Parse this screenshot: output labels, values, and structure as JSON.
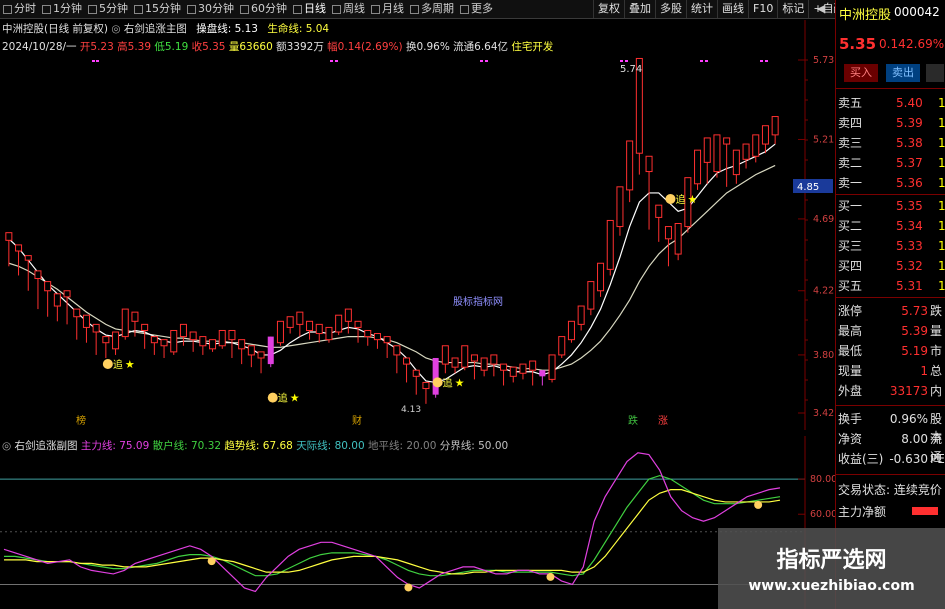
{
  "toolbar": {
    "periods": [
      "分时",
      "1分钟",
      "5分钟",
      "15分钟",
      "30分钟",
      "60分钟",
      "日线",
      "周线",
      "月线",
      "多周期",
      "更多"
    ],
    "active_period": "日线",
    "tools": [
      "复权",
      "叠加",
      "多股",
      "统计",
      "画线",
      "F10",
      "标记",
      "+自选"
    ],
    "back_glyph": "◀"
  },
  "header": {
    "line1": {
      "stock": "中洲控股(日线 前复权)",
      "indicator": "右剑追涨主图",
      "op_label": "操盘线: 5.13",
      "life_label": "生命线: 5.04"
    },
    "line2": {
      "date": "2024/10/28/一",
      "open": "开5.23",
      "high": "高5.39",
      "low": "低5.19",
      "close": "收5.35",
      "volume": "量63660",
      "amount": "额3392万",
      "change": "幅0.14(2.69%)",
      "turnover": "换0.96%",
      "float": "流通6.64亿",
      "sector": "住宅开发"
    }
  },
  "main_chart": {
    "peak_label": "5.74",
    "center_watermark": "股标指标网",
    "current_price_tag": "4.85",
    "signal_text": "追",
    "low_label": "4.13",
    "bottom_markers": [
      {
        "text": "榜",
        "color": "#d4a000"
      },
      {
        "text": "财",
        "color": "#d4a000"
      },
      {
        "text": "跌",
        "color": "#40c040"
      },
      {
        "text": "涨",
        "color": "#ff4040"
      }
    ]
  },
  "price_axis": [
    "5.73",
    "5.21",
    "4.69",
    "4.22",
    "3.80",
    "3.42"
  ],
  "sub_header": {
    "title": "右剑追涨副图",
    "lines": [
      {
        "label": "主力线: 75.09",
        "color": "#e040e0"
      },
      {
        "label": "散户线: 70.32",
        "color": "#40d040"
      },
      {
        "label": "趋势线: 67.68",
        "color": "#ffff40"
      },
      {
        "label": "天际线: 80.00",
        "color": "#40c0c0"
      },
      {
        "label": "地平线: 20.00",
        "color": "#808080"
      },
      {
        "label": "分界线: 50.00",
        "color": "#c0c0c0"
      }
    ]
  },
  "sub_axis": [
    "80.00",
    "60.00"
  ],
  "chart_data": {
    "type": "candlestick",
    "ylim": [
      3.42,
      5.73
    ],
    "candles": [
      [
        5.12,
        5.38,
        5.32,
        5.05
      ],
      [
        5.15,
        5.42,
        5.4,
        5.25
      ],
      [
        5.22,
        5.35,
        5.3,
        5.05
      ],
      [
        5.35,
        5.38,
        5.28,
        5.0
      ],
      [
        5.18,
        5.25,
        5.3,
        5.02
      ],
      [
        5.12,
        5.22,
        5.18,
        5.0
      ],
      [
        5.03,
        5.1,
        5.18,
        4.95
      ],
      [
        5.1,
        5.06,
        5.12,
        5.0
      ],
      [
        5.12,
        5.22,
        5.26,
        5.08
      ],
      [
        5.28,
        5.22,
        5.33,
        5.18
      ],
      [
        5.2,
        5.16,
        5.24,
        5.1
      ],
      [
        5.2,
        5.25,
        5.3,
        5.16
      ],
      [
        5.27,
        5.35,
        5.4,
        5.23
      ],
      [
        5.31,
        5.3,
        5.36,
        5.25
      ]
    ],
    "note": "scaled to visible price range"
  },
  "candles_main": [
    [
      4.55,
      4.6,
      4.48,
      4.38
    ],
    [
      4.48,
      4.52,
      4.4,
      4.32
    ],
    [
      4.42,
      4.45,
      4.28,
      4.22
    ],
    [
      4.3,
      4.35,
      4.2,
      4.1
    ],
    [
      4.22,
      4.28,
      4.12,
      4.05
    ],
    [
      4.12,
      4.2,
      4.18,
      4.02
    ],
    [
      4.18,
      4.22,
      4.05,
      4.0
    ],
    [
      4.05,
      4.1,
      3.96,
      3.9
    ],
    [
      3.98,
      4.06,
      3.94,
      3.88
    ],
    [
      3.95,
      4.0,
      3.85,
      3.8
    ],
    [
      3.88,
      3.92,
      3.82,
      3.78
    ],
    [
      3.84,
      3.95,
      3.92,
      3.8
    ],
    [
      3.92,
      4.1,
      4.05,
      3.9
    ],
    [
      4.02,
      4.08,
      3.96,
      3.92
    ],
    [
      3.96,
      4.0,
      3.88,
      3.84
    ],
    [
      3.88,
      3.92,
      3.85,
      3.8
    ],
    [
      3.86,
      3.9,
      3.82,
      3.78
    ],
    [
      3.82,
      3.96,
      3.94,
      3.8
    ],
    [
      3.92,
      4.0,
      3.9,
      3.86
    ],
    [
      3.9,
      3.95,
      3.86,
      3.82
    ],
    [
      3.86,
      3.92,
      3.84,
      3.8
    ],
    [
      3.84,
      3.9,
      3.86,
      3.82
    ],
    [
      3.86,
      3.96,
      3.92,
      3.84
    ],
    [
      3.9,
      3.96,
      3.84,
      3.78
    ],
    [
      3.84,
      3.9,
      3.78,
      3.74
    ],
    [
      3.8,
      3.86,
      3.76,
      3.72
    ],
    [
      3.78,
      3.82,
      3.72,
      3.68
    ],
    [
      3.74,
      3.92,
      3.88,
      3.72
    ],
    [
      3.88,
      4.02,
      3.98,
      3.86
    ],
    [
      3.98,
      4.05,
      4.02,
      3.94
    ],
    [
      4.0,
      4.08,
      3.96,
      3.92
    ],
    [
      3.96,
      4.02,
      3.94,
      3.9
    ],
    [
      3.94,
      4.0,
      3.9,
      3.88
    ],
    [
      3.9,
      3.98,
      3.96,
      3.88
    ],
    [
      3.95,
      4.06,
      4.04,
      3.93
    ],
    [
      4.02,
      4.1,
      3.98,
      3.94
    ],
    [
      3.98,
      4.02,
      3.92,
      3.88
    ],
    [
      3.92,
      3.96,
      3.9,
      3.86
    ],
    [
      3.9,
      3.94,
      3.88,
      3.84
    ],
    [
      3.88,
      3.92,
      3.8,
      3.78
    ],
    [
      3.8,
      3.86,
      3.72,
      3.68
    ],
    [
      3.74,
      3.78,
      3.66,
      3.62
    ],
    [
      3.66,
      3.7,
      3.58,
      3.54
    ],
    [
      3.58,
      3.62,
      3.52,
      3.48
    ],
    [
      3.54,
      3.78,
      3.76,
      3.52
    ],
    [
      3.74,
      3.86,
      3.72,
      3.68
    ],
    [
      3.72,
      3.78,
      3.74,
      3.68
    ],
    [
      3.72,
      3.86,
      3.76,
      3.7
    ],
    [
      3.76,
      3.8,
      3.7,
      3.64
    ],
    [
      3.7,
      3.78,
      3.74,
      3.66
    ],
    [
      3.74,
      3.8,
      3.7,
      3.66
    ],
    [
      3.7,
      3.74,
      3.66,
      3.6
    ],
    [
      3.66,
      3.72,
      3.68,
      3.62
    ],
    [
      3.68,
      3.74,
      3.7,
      3.64
    ],
    [
      3.7,
      3.76,
      3.66,
      3.6
    ],
    [
      3.66,
      3.7,
      3.64,
      3.6
    ],
    [
      3.64,
      3.8,
      3.78,
      3.62
    ],
    [
      3.8,
      3.92,
      3.9,
      3.78
    ],
    [
      3.9,
      4.02,
      4.0,
      3.88
    ],
    [
      4.0,
      4.12,
      4.1,
      3.96
    ],
    [
      4.1,
      4.28,
      4.24,
      4.06
    ],
    [
      4.22,
      4.4,
      4.36,
      4.18
    ],
    [
      4.36,
      4.68,
      4.64,
      4.32
    ],
    [
      4.64,
      4.9,
      4.86,
      4.58
    ],
    [
      4.88,
      5.2,
      5.14,
      4.8
    ],
    [
      5.12,
      5.74,
      5.0,
      4.98
    ],
    [
      5.0,
      5.1,
      4.7,
      4.62
    ],
    [
      4.7,
      4.78,
      4.6,
      4.54
    ],
    [
      4.56,
      4.64,
      4.44,
      4.38
    ],
    [
      4.46,
      4.66,
      4.62,
      4.42
    ],
    [
      4.64,
      4.96,
      4.92,
      4.6
    ],
    [
      4.92,
      5.14,
      5.08,
      4.88
    ],
    [
      5.06,
      5.22,
      5.02,
      4.92
    ],
    [
      5.0,
      5.24,
      5.2,
      4.96
    ],
    [
      5.18,
      5.22,
      4.98,
      4.9
    ],
    [
      4.98,
      5.14,
      5.08,
      4.92
    ],
    [
      5.08,
      5.18,
      5.1,
      5.02
    ],
    [
      5.1,
      5.24,
      5.18,
      5.06
    ],
    [
      5.18,
      5.3,
      5.24,
      5.12
    ],
    [
      5.24,
      5.36,
      5.35,
      5.18
    ]
  ],
  "ma_short": [
    4.56,
    4.5,
    4.42,
    4.34,
    4.26,
    4.2,
    4.14,
    4.08,
    4.02,
    3.97,
    3.93,
    3.92,
    3.94,
    3.96,
    3.95,
    3.92,
    3.89,
    3.88,
    3.89,
    3.89,
    3.88,
    3.87,
    3.88,
    3.88,
    3.86,
    3.84,
    3.8,
    3.8,
    3.83,
    3.88,
    3.92,
    3.95,
    3.95,
    3.94,
    3.96,
    3.98,
    3.97,
    3.94,
    3.92,
    3.88,
    3.84,
    3.78,
    3.7,
    3.63,
    3.62,
    3.64,
    3.68,
    3.72,
    3.73,
    3.72,
    3.73,
    3.71,
    3.69,
    3.69,
    3.69,
    3.67,
    3.69,
    3.74,
    3.8,
    3.88,
    3.98,
    4.1,
    4.26,
    4.44,
    4.64,
    4.8,
    4.86,
    4.86,
    4.8,
    4.74,
    4.76,
    4.84,
    4.92,
    4.99,
    5.02,
    5.04,
    5.07,
    5.1,
    5.13,
    5.18
  ],
  "ma_long": [
    4.4,
    4.38,
    4.35,
    4.31,
    4.27,
    4.23,
    4.18,
    4.13,
    4.08,
    4.04,
    4.0,
    3.97,
    3.96,
    3.95,
    3.94,
    3.93,
    3.92,
    3.91,
    3.91,
    3.9,
    3.89,
    3.89,
    3.89,
    3.88,
    3.88,
    3.87,
    3.86,
    3.85,
    3.85,
    3.86,
    3.87,
    3.88,
    3.89,
    3.9,
    3.91,
    3.92,
    3.92,
    3.92,
    3.91,
    3.9,
    3.88,
    3.85,
    3.82,
    3.78,
    3.76,
    3.75,
    3.75,
    3.75,
    3.75,
    3.74,
    3.74,
    3.73,
    3.72,
    3.71,
    3.71,
    3.7,
    3.7,
    3.72,
    3.74,
    3.78,
    3.83,
    3.89,
    3.97,
    4.06,
    4.16,
    4.28,
    4.38,
    4.46,
    4.52,
    4.56,
    4.62,
    4.68,
    4.74,
    4.8,
    4.86,
    4.9,
    4.94,
    4.98,
    5.01,
    5.04
  ],
  "sub_data": {
    "ylim": [
      10,
      100
    ],
    "main_line": [
      40,
      38,
      36,
      34,
      32,
      33,
      34,
      30,
      28,
      27,
      26,
      28,
      32,
      34,
      36,
      38,
      40,
      42,
      40,
      36,
      30,
      24,
      18,
      16,
      24,
      30,
      36,
      40,
      42,
      44,
      44,
      42,
      40,
      38,
      36,
      30,
      24,
      20,
      18,
      22,
      26,
      28,
      30,
      30,
      28,
      26,
      26,
      28,
      28,
      26,
      26,
      22,
      20,
      30,
      56,
      70,
      80,
      90,
      95,
      94,
      85,
      70,
      62,
      58,
      56,
      58,
      62,
      66,
      70,
      72,
      74,
      75
    ],
    "retail_line": [
      36,
      36,
      35,
      34,
      33,
      33,
      33,
      32,
      31,
      30,
      29,
      29,
      30,
      31,
      32,
      34,
      36,
      37,
      37,
      36,
      34,
      31,
      28,
      25,
      25,
      26,
      29,
      32,
      35,
      37,
      38,
      38,
      38,
      37,
      36,
      34,
      31,
      28,
      26,
      25,
      25,
      26,
      27,
      28,
      28,
      28,
      27,
      27,
      27,
      27,
      27,
      26,
      25,
      26,
      34,
      44,
      54,
      64,
      72,
      80,
      82,
      80,
      76,
      72,
      68,
      66,
      66,
      66,
      67,
      68,
      69,
      70
    ],
    "trend_line": [
      34,
      34,
      34,
      33,
      33,
      33,
      33,
      32,
      32,
      31,
      31,
      30,
      30,
      30,
      31,
      32,
      33,
      34,
      35,
      35,
      34,
      33,
      31,
      29,
      27,
      27,
      27,
      28,
      30,
      32,
      34,
      35,
      36,
      36,
      36,
      35,
      34,
      32,
      30,
      28,
      27,
      26,
      26,
      27,
      27,
      28,
      28,
      28,
      28,
      28,
      28,
      28,
      27,
      27,
      30,
      36,
      44,
      52,
      60,
      68,
      72,
      74,
      74,
      72,
      70,
      68,
      67,
      67,
      67,
      67,
      67,
      68
    ],
    "sky": 80,
    "ground": 20,
    "boundary": 50
  },
  "right_panel": {
    "name": "中洲控股",
    "code": "000042",
    "price": "5.35",
    "change": "0.14",
    "pct": "2.69%",
    "buy_btn": "买入",
    "sell_btn": "卖出",
    "sells": [
      {
        "label": "卖五",
        "price": "5.40",
        "vol": "1"
      },
      {
        "label": "卖四",
        "price": "5.39",
        "vol": "1"
      },
      {
        "label": "卖三",
        "price": "5.38",
        "vol": "1"
      },
      {
        "label": "卖二",
        "price": "5.37",
        "vol": "1"
      },
      {
        "label": "卖一",
        "price": "5.36",
        "vol": "1"
      }
    ],
    "buys": [
      {
        "label": "买一",
        "price": "5.35",
        "vol": "1"
      },
      {
        "label": "买二",
        "price": "5.34",
        "vol": "1"
      },
      {
        "label": "买三",
        "price": "5.33",
        "vol": "1"
      },
      {
        "label": "买四",
        "price": "5.32",
        "vol": "1"
      },
      {
        "label": "买五",
        "price": "5.31",
        "vol": "1"
      }
    ],
    "stats": [
      {
        "label": "涨停",
        "value": "5.73",
        "tail": "跌"
      },
      {
        "label": "最高",
        "value": "5.39",
        "tail": "量"
      },
      {
        "label": "最低",
        "value": "5.19",
        "tail": "市"
      },
      {
        "label": "现量",
        "value": "1",
        "tail": "总"
      },
      {
        "label": "外盘",
        "value": "33173",
        "tail": "内"
      }
    ],
    "stats2": [
      {
        "label": "换手",
        "value": "0.96%",
        "tail": "股本"
      },
      {
        "label": "净资",
        "value": "8.00",
        "tail": "流通"
      },
      {
        "label": "收益(三)",
        "value": "-0.630",
        "tail": "PE("
      }
    ],
    "trade_status": "交易状态: 连续竞价",
    "net_flow": "主力净额"
  },
  "watermark": {
    "cn": "指标严选网",
    "url": "www.xuezhibiao.com"
  }
}
